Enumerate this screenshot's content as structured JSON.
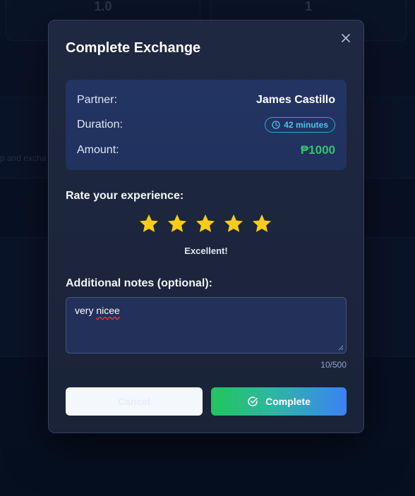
{
  "background": {
    "stat_1_value": "1.0",
    "stat_2_value": "1",
    "snippet_text": "p and excha"
  },
  "modal": {
    "title": "Complete Exchange",
    "close_icon": "close-icon",
    "info": {
      "partner_label": "Partner:",
      "partner_value": "James Castillo",
      "duration_label": "Duration:",
      "duration_value": "42 minutes",
      "amount_label": "Amount:",
      "amount_value": "₱1000"
    },
    "rating": {
      "label": "Rate your experience:",
      "stars_filled": 5,
      "stars_total": 5,
      "star_color": "#facc15",
      "rating_text": "Excellent!"
    },
    "notes": {
      "label": "Additional notes (optional):",
      "value_plain": "very ",
      "value_misspelled": "nicee",
      "char_count": "10/500"
    },
    "buttons": {
      "cancel_label": "Cancel",
      "complete_label": "Complete"
    },
    "colors": {
      "amount": "#34c46e",
      "duration_badge": "#4cc3f0",
      "complete_gradient_start": "#22c55e",
      "complete_gradient_end": "#3b82f6"
    }
  }
}
